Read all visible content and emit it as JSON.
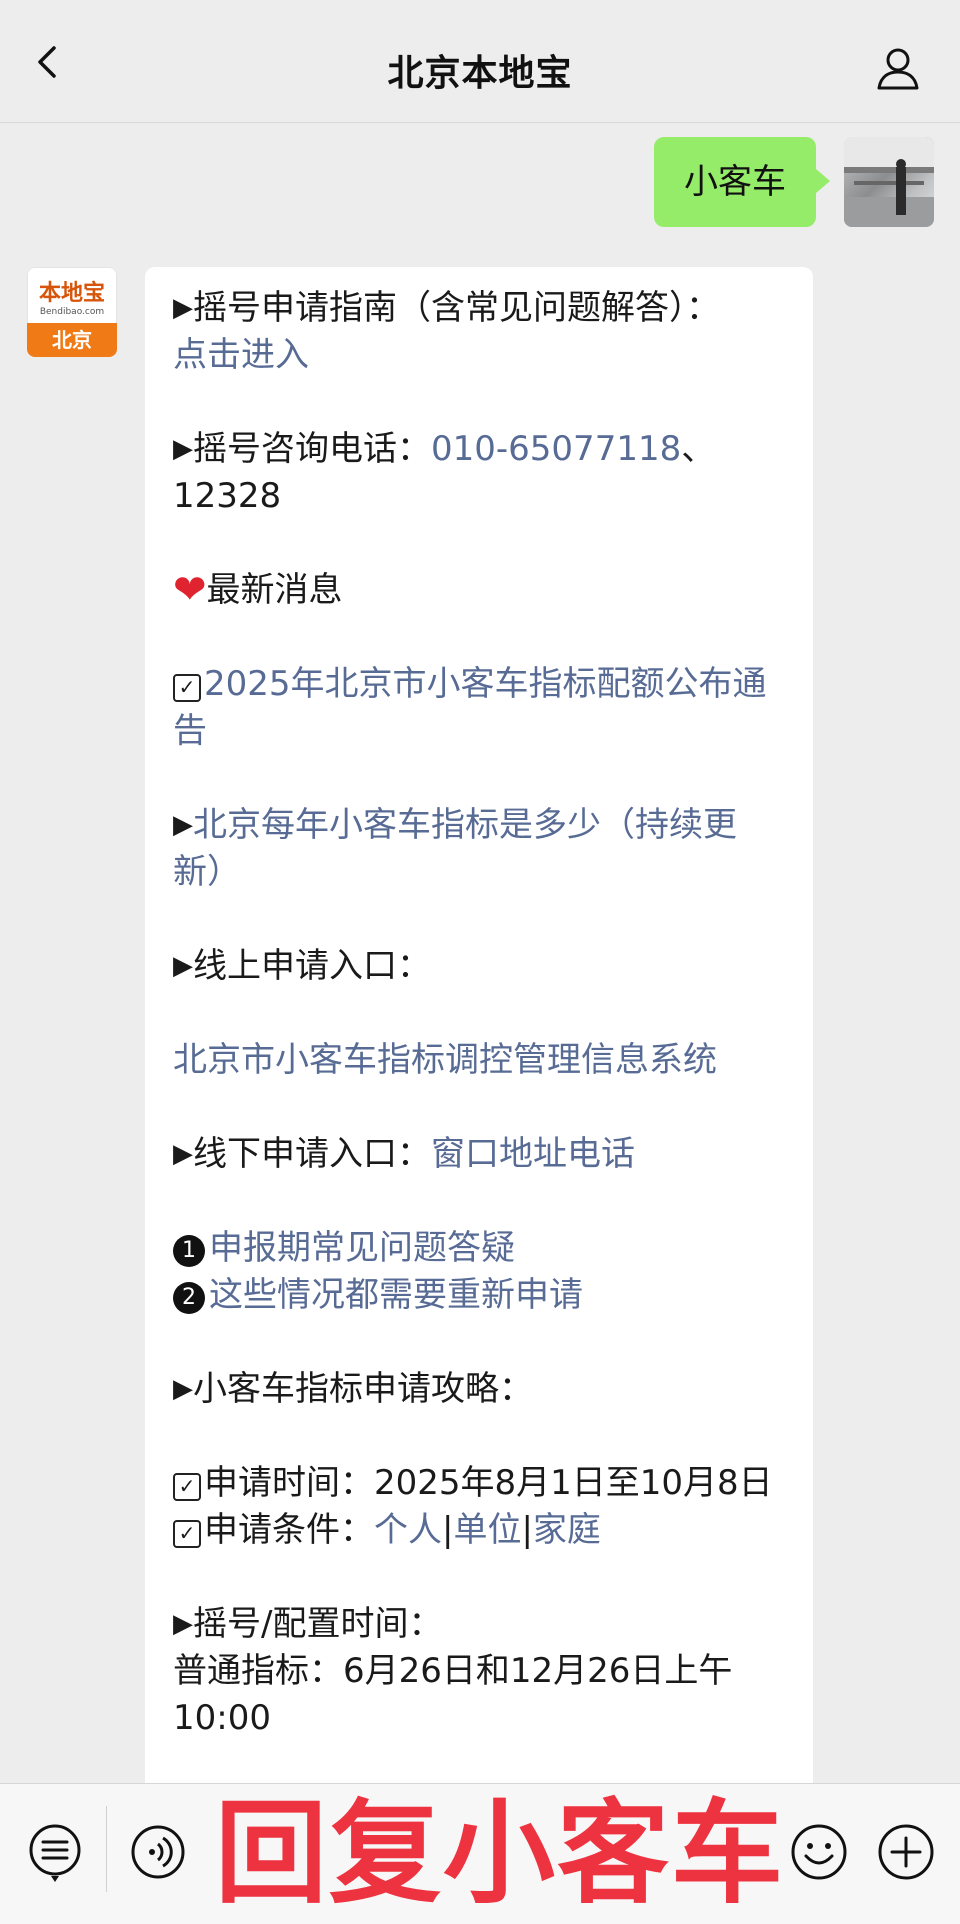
{
  "header": {
    "title": "北京本地宝"
  },
  "user_message": {
    "text": "小客车"
  },
  "bot_avatar": {
    "logo_text": "本地宝",
    "logo_url": "Bendibao.com",
    "logo_city": "北京"
  },
  "reply": {
    "p1": {
      "prefix": "摇号申请指南（含常见问题解答）：",
      "link": "点击进入"
    },
    "p2": {
      "prefix": "摇号咨询电话：",
      "link": "010-65077118",
      "suffix": "、12328"
    },
    "p3": {
      "text": "最新消息"
    },
    "p4": {
      "link": "2025年北京市小客车指标配额公布通告"
    },
    "p5": {
      "link": "北京每年小客车指标是多少（持续更新）"
    },
    "p6": {
      "text": "线上申请入口："
    },
    "p7": {
      "link": "北京市小客车指标调控管理信息系统"
    },
    "p8": {
      "prefix": "线下申请入口：",
      "link": "窗口地址电话"
    },
    "p9": {
      "item1": "申报期常见问题答疑",
      "item2": "这些情况都需要重新申请"
    },
    "p10": {
      "text": "小客车指标申请攻略："
    },
    "p11": {
      "time_label": "申请时间：",
      "time_value": "2025年8月1日至10月8日",
      "cond_label": "申请条件：",
      "cond_personal": "个人",
      "sep": "|",
      "cond_unit": "单位",
      "cond_family": "家庭"
    },
    "p12": {
      "label": "摇号/配置时间：",
      "value": "普通指标：6月26日和12月26日上午10:00"
    }
  },
  "bottom": {
    "overlay_text": "回复小客车"
  },
  "icons": {
    "back": "chevron-left-icon",
    "profile": "user-icon",
    "menu": "list-icon",
    "voice": "voice-icon",
    "emoji": "emoji-icon",
    "plus": "plus-icon"
  },
  "colors": {
    "link": "#576b95",
    "bubble_me": "#95ec69",
    "overlay": "#ee3340"
  }
}
